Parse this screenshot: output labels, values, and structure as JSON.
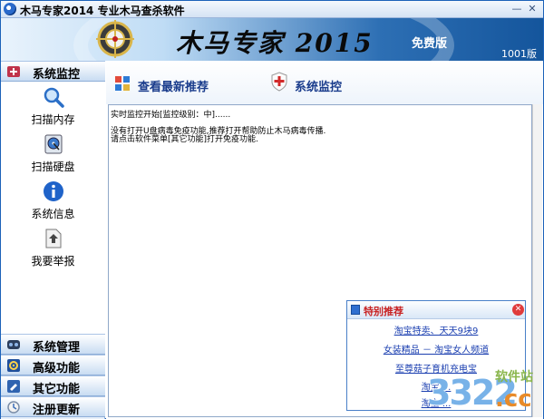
{
  "window": {
    "title": "木马专家2014  专业木马查杀软件",
    "minimize": "—",
    "close": "✕"
  },
  "banner": {
    "title": "木马专家 2015",
    "badge": "免费版",
    "version": "1001版"
  },
  "sidebar": {
    "sections": [
      {
        "label": "系统监控"
      },
      {
        "label": "系统管理"
      },
      {
        "label": "高级功能"
      },
      {
        "label": "其它功能"
      },
      {
        "label": "注册更新"
      }
    ],
    "tools": [
      {
        "label": "扫描内存",
        "icon": "magnifier-icon"
      },
      {
        "label": "扫描硬盘",
        "icon": "hard-disk-icon"
      },
      {
        "label": "系统信息",
        "icon": "info-icon"
      },
      {
        "label": "我要举报",
        "icon": "report-icon"
      }
    ]
  },
  "toolbar": {
    "recommend_label": "查看最新推荐",
    "monitor_label": "系统监控"
  },
  "log": {
    "lines": [
      "实时监控开始[监控级别：中]......",
      "",
      "没有打开U盘病毒免疫功能,推荐打开帮助防止木马病毒传播.",
      "请点击软件菜单[其它功能]打开免疫功能."
    ]
  },
  "popup": {
    "title": "特别推荐",
    "links": [
      "淘宝特卖、天天9块9",
      "女装精品 － 淘宝女人频道",
      "至尊菇子育机充电宝",
      "淘宝 ...",
      "淘宝 ..."
    ]
  },
  "watermark": {
    "site": "软件站",
    "number": "3322",
    "domain": ".cc"
  },
  "colors": {
    "accent": "#1c62b9",
    "link": "#1b3fb0",
    "popup_title": "#c82323"
  }
}
